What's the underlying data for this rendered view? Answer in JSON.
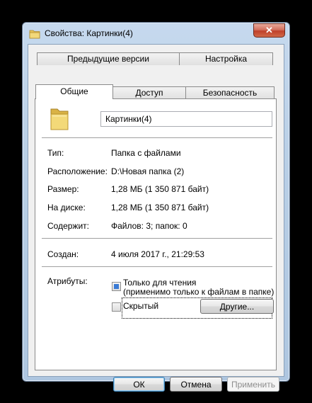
{
  "window": {
    "title": "Свойства: Картинки(4)",
    "close_label": "✕"
  },
  "tabs": {
    "row1": [
      "Предыдущие версии",
      "Настройка"
    ],
    "row2": [
      "Общие",
      "Доступ",
      "Безопасность"
    ],
    "active": "Общие"
  },
  "general": {
    "name_value": "Картинки(4)",
    "fields": [
      {
        "label": "Тип:",
        "value": "Папка с файлами"
      },
      {
        "label": "Расположение:",
        "value": "D:\\Новая папка (2)"
      },
      {
        "label": "Размер:",
        "value": "1,28 МБ (1 350 871 байт)"
      },
      {
        "label": "На диске:",
        "value": "1,28 МБ (1 350 871 байт)"
      },
      {
        "label": "Содержит:",
        "value": "Файлов: 3; папок: 0"
      }
    ],
    "created_label": "Создан:",
    "created_value": "4 июля 2017 г., 21:29:53",
    "attributes_label": "Атрибуты:",
    "readonly_line1": "Только для чтения",
    "readonly_line2": "(применимо только к файлам в папке)",
    "readonly_state": "indeterminate",
    "hidden_label": "Скрытый",
    "hidden_checked": false,
    "other_button": "Другие..."
  },
  "footer": {
    "ok": "ОК",
    "cancel": "Отмена",
    "apply": "Применить"
  },
  "colors": {
    "accent": "#3a7bd5",
    "folder": "#e8c45a"
  }
}
